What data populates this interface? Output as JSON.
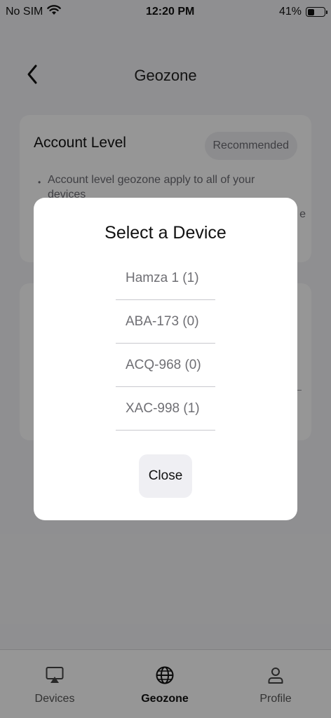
{
  "status_bar": {
    "carrier": "No SIM",
    "time": "12:20 PM",
    "battery_percent_label": "41%",
    "battery_level": 0.41
  },
  "header": {
    "title": "Geozone"
  },
  "account_card": {
    "title": "Account Level",
    "badge": "Recommended",
    "bullet_text": "Account level geozone apply to all of your devices",
    "edge_char": "e"
  },
  "modal": {
    "title": "Select a Device",
    "devices": [
      "Hamza 1 (1)",
      "ABA-173 (0)",
      "ACQ-968 (0)",
      "XAC-998 (1)"
    ],
    "close_label": "Close"
  },
  "tab_bar": {
    "tabs": [
      {
        "label": "Devices",
        "icon": "airplay-icon"
      },
      {
        "label": "Geozone",
        "icon": "globe-icon",
        "active": true
      },
      {
        "label": "Profile",
        "icon": "user-icon"
      }
    ]
  }
}
